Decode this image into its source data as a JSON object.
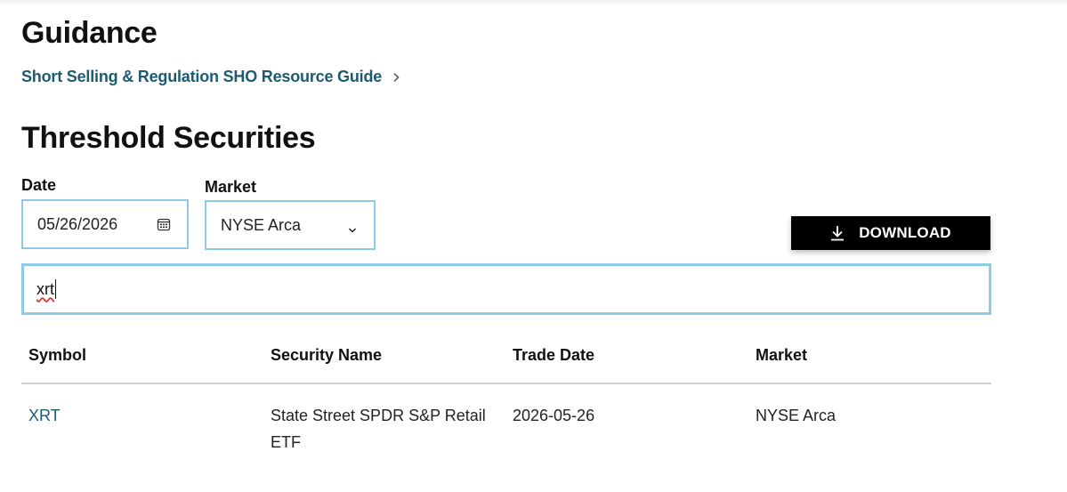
{
  "guidance": {
    "heading": "Guidance",
    "resource_link": "Short Selling & Regulation SHO Resource Guide"
  },
  "threshold": {
    "heading": "Threshold Securities"
  },
  "filters": {
    "date_label": "Date",
    "date_value": "05/26/2026",
    "market_label": "Market",
    "market_value": "NYSE Arca"
  },
  "download": {
    "label": "DOWNLOAD"
  },
  "search": {
    "value": "xrt"
  },
  "table": {
    "columns": [
      "Symbol",
      "Security Name",
      "Trade Date",
      "Market"
    ],
    "rows": [
      {
        "symbol": "XRT",
        "security_name": "State Street SPDR S&P Retail ETF",
        "trade_date": "2026-05-26",
        "market": "NYSE Arca"
      }
    ]
  },
  "icons": {
    "link_chevron": "chevron-right-icon",
    "date_picker": "calendar-icon",
    "select_caret": "chevron-down-icon",
    "download": "download-icon"
  },
  "colors": {
    "link": "#1e5b70",
    "input_border": "#8ccbe6",
    "button_bg": "#000000",
    "button_text": "#ffffff",
    "table_rule": "#d0d0d0"
  }
}
